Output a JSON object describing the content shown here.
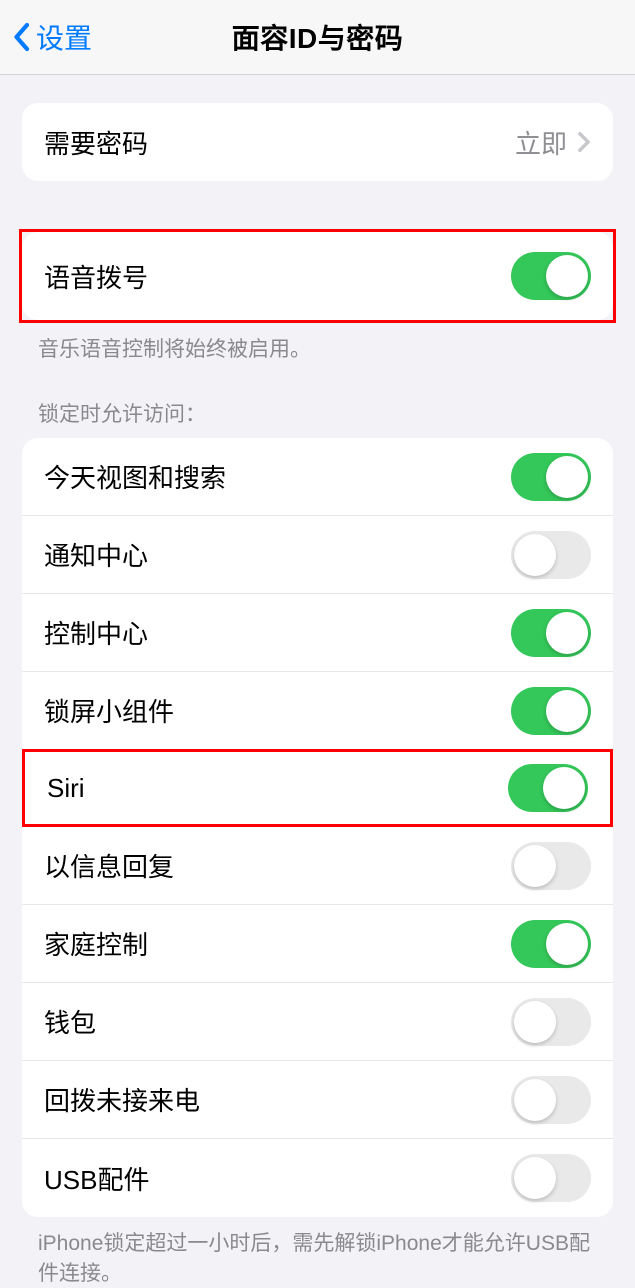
{
  "nav": {
    "back": "设置",
    "title": "面容ID与密码"
  },
  "requirePasscode": {
    "label": "需要密码",
    "value": "立即"
  },
  "voiceDial": {
    "label": "语音拨号",
    "on": true,
    "footer": "音乐语音控制将始终被启用。"
  },
  "lockAccess": {
    "header": "锁定时允许访问：",
    "items": [
      {
        "label": "今天视图和搜索",
        "on": true
      },
      {
        "label": "通知中心",
        "on": false
      },
      {
        "label": "控制中心",
        "on": true
      },
      {
        "label": "锁屏小组件",
        "on": true
      },
      {
        "label": "Siri",
        "on": true
      },
      {
        "label": "以信息回复",
        "on": false
      },
      {
        "label": "家庭控制",
        "on": true
      },
      {
        "label": "钱包",
        "on": false
      },
      {
        "label": "回拨未接来电",
        "on": false
      },
      {
        "label": "USB配件",
        "on": false
      }
    ],
    "footer": "iPhone锁定超过一小时后，需先解锁iPhone才能允许USB配件连接。"
  }
}
